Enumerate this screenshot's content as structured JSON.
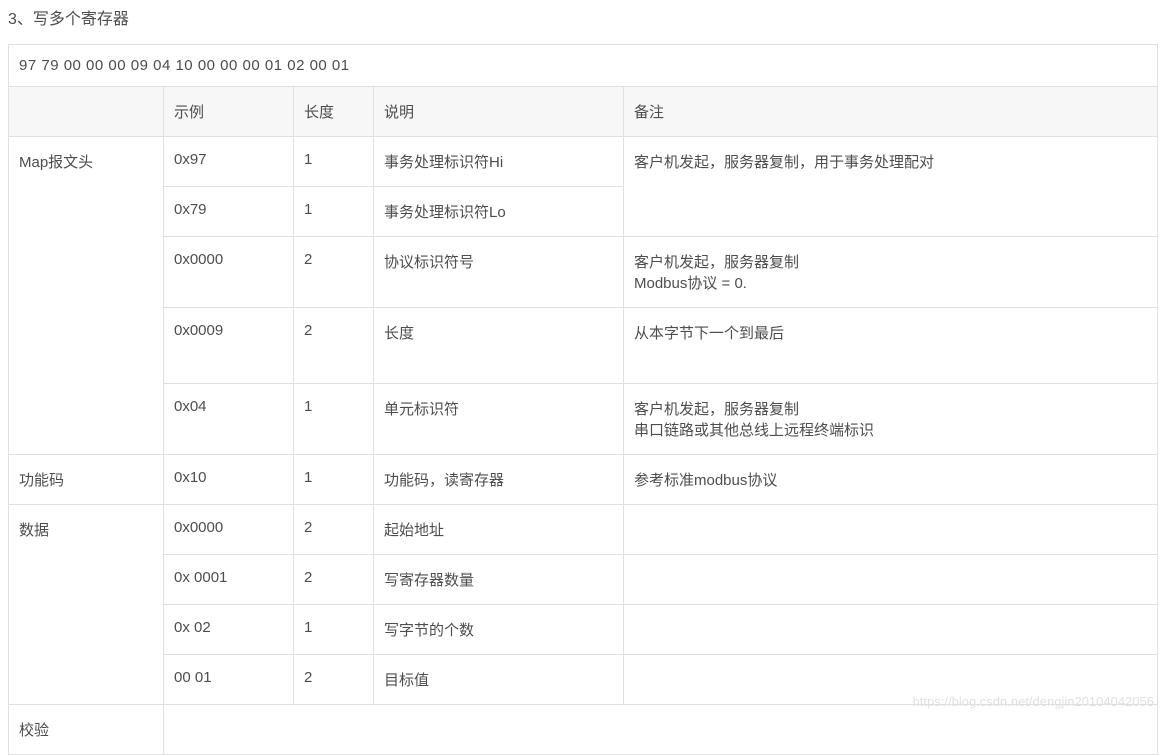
{
  "heading": "3、写多个寄存器",
  "hex_string": "97 79 00 00 00 09 04 10 00 00 00 01 02 00 01",
  "columns": {
    "section": "",
    "example": "示例",
    "length": "长度",
    "desc": "说明",
    "notes": "备注"
  },
  "rows": [
    {
      "section": "Map报文头",
      "example": "0x97",
      "length": "1",
      "desc": "事务处理标识符Hi",
      "notes": "客户机发起，服务器复制，用于事务处理配对",
      "section_rowspan": 5,
      "notes_rowspan": 2
    },
    {
      "example": "0x79",
      "length": "1",
      "desc": "事务处理标识符Lo"
    },
    {
      "example": "0x0000",
      "length": "2",
      "desc": "协议标识符号",
      "notes": "客户机发起，服务器复制\nModbus协议 = 0."
    },
    {
      "example": "0x0009",
      "length": "2",
      "desc": "长度",
      "notes": "从本字节下一个到最后",
      "tall": true
    },
    {
      "example": "0x04",
      "length": "1",
      "desc": "单元标识符",
      "notes": "客户机发起，服务器复制\n串口链路或其他总线上远程终端标识"
    },
    {
      "section": "功能码",
      "example": "0x10",
      "length": "1",
      "desc": "功能码，读寄存器",
      "notes": "参考标准modbus协议"
    },
    {
      "section": "数据",
      "example": "0x0000",
      "length": "2",
      "desc": "起始地址",
      "notes": "",
      "section_rowspan": 4
    },
    {
      "example": "0x 0001",
      "length": "2",
      "desc": "写寄存器数量",
      "notes": ""
    },
    {
      "example": "0x 02",
      "length": "1",
      "desc": "写字节的个数",
      "notes": ""
    },
    {
      "example": "00 01",
      "length": "2",
      "desc": "目标值",
      "notes": ""
    },
    {
      "section": "校验",
      "full_empty": true
    }
  ],
  "watermark": "https://blog.csdn.net/dengjin20104042056"
}
